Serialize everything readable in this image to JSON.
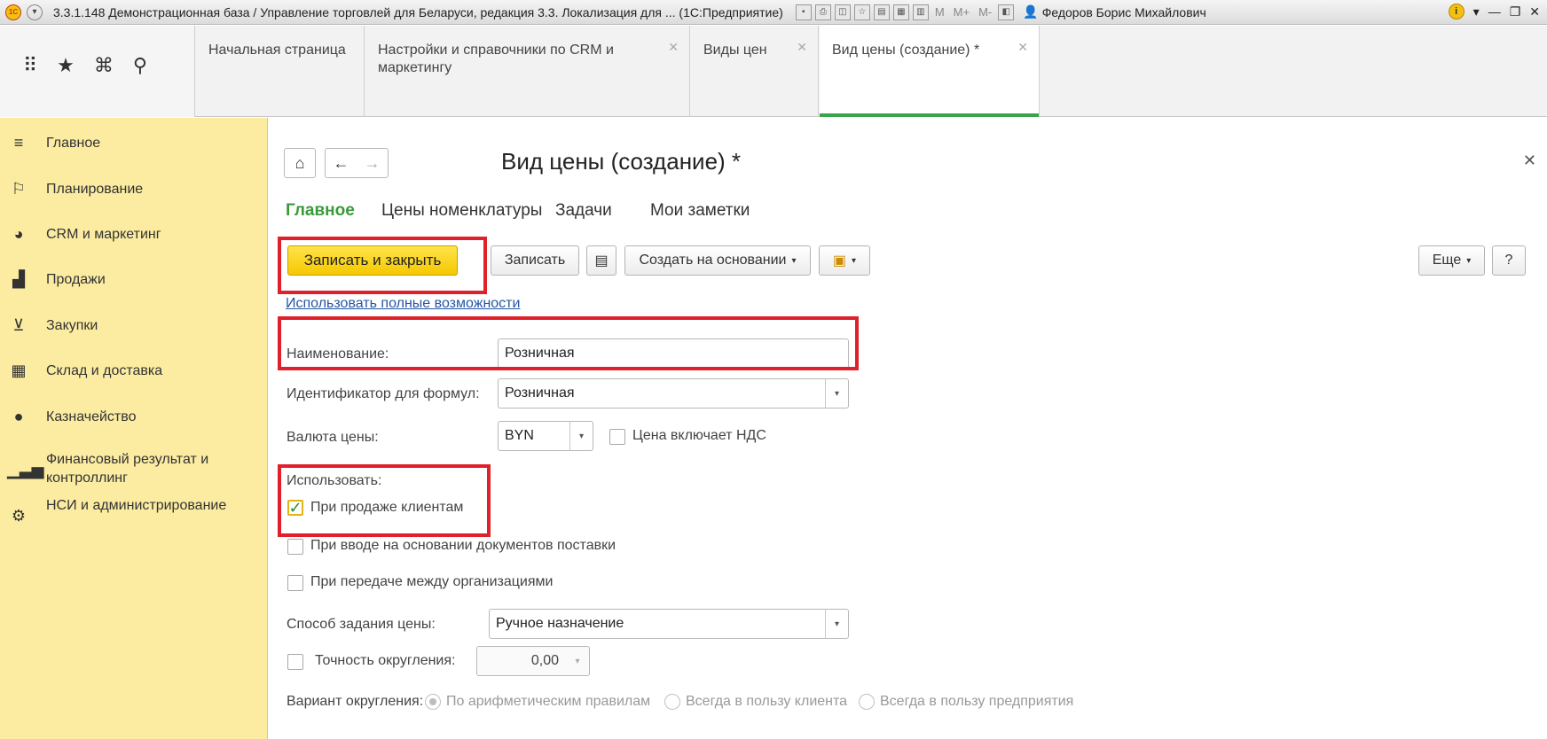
{
  "window": {
    "title": "3.3.1.148 Демонстрационная база / Управление торговлей для Беларуси, редакция 3.3. Локализация для ... (1С:Предприятие)",
    "m_labels": [
      "M",
      "M+",
      "M-"
    ],
    "user": "Федоров Борис Михайлович",
    "info": "i"
  },
  "tabs": [
    {
      "label": "Начальная страница"
    },
    {
      "label": "Настройки и справочники по CRM и маркетингу"
    },
    {
      "label": "Виды цен"
    },
    {
      "label": "Вид цены (создание) *"
    }
  ],
  "sidebar": {
    "items": [
      {
        "label": "Главное",
        "icon": "hamburger-icon"
      },
      {
        "label": "Планирование",
        "icon": "planning-icon"
      },
      {
        "label": "CRM и маркетинг",
        "icon": "pie-chart-icon"
      },
      {
        "label": "Продажи",
        "icon": "shopping-bag-icon"
      },
      {
        "label": "Закупки",
        "icon": "cart-icon"
      },
      {
        "label": "Склад и доставка",
        "icon": "warehouse-icon"
      },
      {
        "label": "Казначейство",
        "icon": "ruble-coin-icon"
      },
      {
        "label": "Финансовый результат и контроллинг",
        "icon": "bar-chart-icon"
      },
      {
        "label": "НСИ и администрирование",
        "icon": "gear-icon"
      }
    ]
  },
  "form": {
    "title": "Вид цены (создание) *",
    "tabs": [
      "Главное",
      "Цены номенклатуры",
      "Задачи",
      "Мои заметки"
    ],
    "toolbar": {
      "save_close": "Записать и закрыть",
      "save": "Записать",
      "create_based": "Создать на основании",
      "more": "Еще",
      "help": "?"
    },
    "full_link": "Использовать полные возможности",
    "name_label": "Наименование:",
    "name_value": "Розничная",
    "id_label": "Идентификатор для формул:",
    "id_value": "Розничная",
    "currency_label": "Валюта цены:",
    "currency_value": "BYN",
    "vat_label": "Цена включает НДС",
    "use_label": "Использовать:",
    "use_sell": "При продаже клиентам",
    "use_supply": "При вводе на основании документов поставки",
    "use_transfer": "При передаче между организациями",
    "method_label": "Способ задания цены:",
    "method_value": "Ручное назначение",
    "rounding_label": "Точность округления:",
    "rounding_value": "0,00",
    "variant_label": "Вариант округления:",
    "variant_options": [
      "По арифметическим правилам",
      "Всегда в пользу клиента",
      "Всегда в пользу предприятия"
    ]
  },
  "colors": {
    "sidebar_bg": "#fbeca1",
    "accent_green": "#3aa44b",
    "primary_button": "#f5c800",
    "highlight": "#e0202a",
    "link": "#2456a5"
  }
}
